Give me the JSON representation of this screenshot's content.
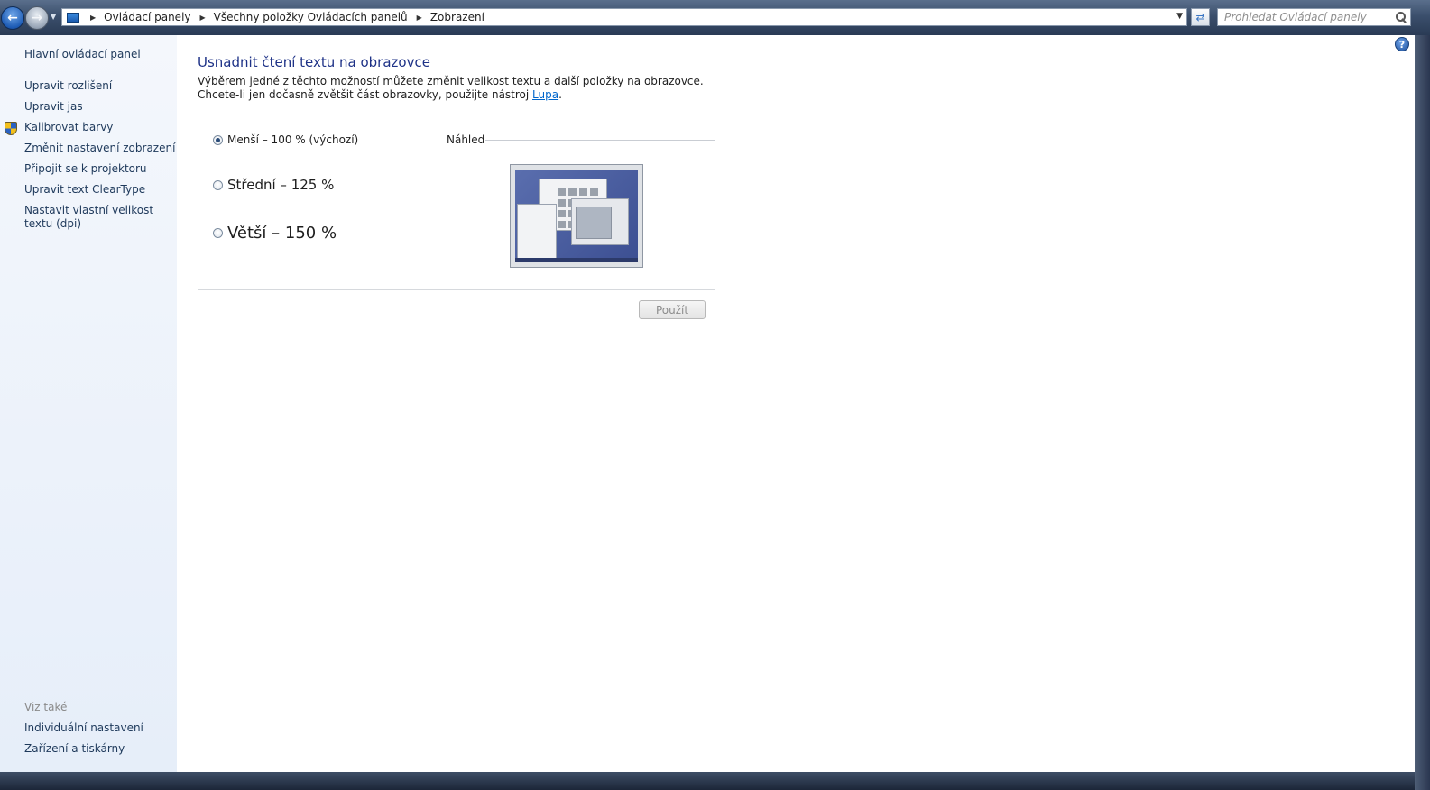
{
  "toolbar": {
    "breadcrumbs": [
      "Ovládací panely",
      "Všechny položky Ovládacích panelů",
      "Zobrazení"
    ],
    "search_placeholder": "Prohledat Ovládací panely"
  },
  "sidebar": {
    "main_link": "Hlavní ovládací panel",
    "items": [
      {
        "label": "Upravit rozlišení"
      },
      {
        "label": "Upravit jas"
      },
      {
        "label": "Kalibrovat barvy",
        "icon": "shield-icon"
      },
      {
        "label": "Změnit nastavení zobrazení"
      },
      {
        "label": "Připojit se k projektoru"
      },
      {
        "label": "Upravit text ClearType"
      },
      {
        "label": "Nastavit vlastní velikost textu (dpi)"
      }
    ],
    "see_also_heading": "Viz také",
    "see_also": [
      {
        "label": "Individuální nastavení"
      },
      {
        "label": "Zařízení a tiskárny"
      }
    ]
  },
  "main": {
    "title": "Usnadnit čtení textu na obrazovce",
    "description_before": "Výběrem jedné z těchto možností můžete změnit velikost textu a další položky na obrazovce. Chcete-li jen dočasně zvětšit část obrazovky, použijte nástroj ",
    "description_link": "Lupa",
    "description_after": ".",
    "options": [
      {
        "label": "Menší – 100 % (výchozí)",
        "selected": true
      },
      {
        "label": "Střední – 125 %",
        "selected": false
      },
      {
        "label": "Větší – 150 %",
        "selected": false
      }
    ],
    "preview_label": "Náhled",
    "apply_label": "Použít",
    "apply_enabled": false
  },
  "colors": {
    "title": "#1e3287",
    "link": "#0066cc",
    "sidebar_link": "#1e395b"
  }
}
